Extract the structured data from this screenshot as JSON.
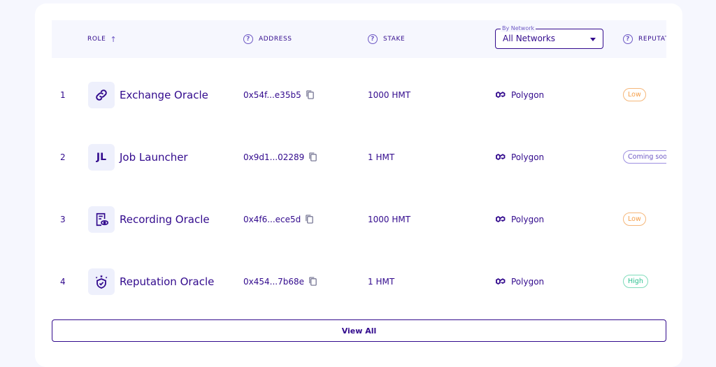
{
  "header": {
    "role": "ROLE",
    "address": "ADDRESS",
    "stake": "STAKE",
    "reputation": "REPUTATION",
    "network_filter": {
      "legend": "By Network",
      "selected": "All Networks"
    }
  },
  "rows": [
    {
      "index": "1",
      "role": "Exchange Oracle",
      "role_icon": "link-icon",
      "address": "0x54f...e35b5",
      "stake": "1000 HMT",
      "network": "Polygon",
      "reputation": "Low"
    },
    {
      "index": "2",
      "role": "Job Launcher",
      "role_icon": "jl-initials-icon",
      "role_initials": "JL",
      "address": "0x9d1...02289",
      "stake": "1 HMT",
      "network": "Polygon",
      "reputation": "Coming soon"
    },
    {
      "index": "3",
      "role": "Recording Oracle",
      "role_icon": "document-eye-icon",
      "address": "0x4f6...ece5d",
      "stake": "1000 HMT",
      "network": "Polygon",
      "reputation": "Low"
    },
    {
      "index": "4",
      "role": "Reputation Oracle",
      "role_icon": "shield-stars-icon",
      "address": "0x454...7b68e",
      "stake": "1 HMT",
      "network": "Polygon",
      "reputation": "High"
    }
  ],
  "footer": {
    "view_all": "View All"
  },
  "colors": {
    "primary": "#320a8d",
    "low": "#f59f4a",
    "high": "#29c08e",
    "soon": "#6d58c4"
  }
}
